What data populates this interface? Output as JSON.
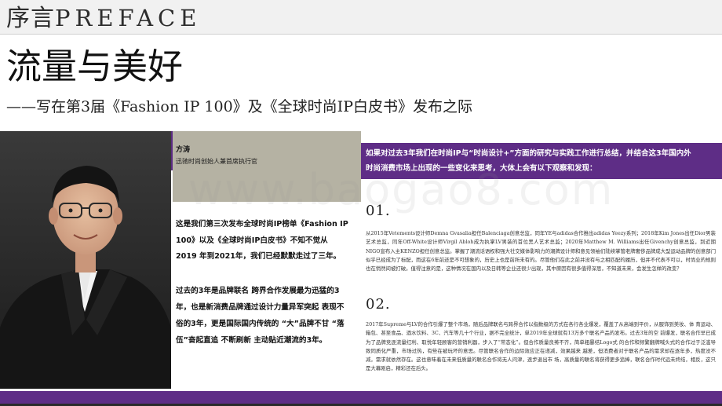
{
  "header": {
    "preface_cn": "序言",
    "preface_en": "PREFACE"
  },
  "title": "流量与美好",
  "subtitle": "——写在第3届《Fashion IP 100》及《全球时尚IP白皮书》发布之际",
  "author": {
    "name": "方涛",
    "role": "迅驰时尚创始人兼首席执行官"
  },
  "intro": {
    "p1_lines": [
      "这是我们第三次发布全球时尚IP榜单《Fashion IP",
      "100》以及《全球时尚IP白皮书》不知不觉从",
      "2019 年到2021年，我们已经默默走过了三年。"
    ],
    "p2_lines": [
      "过去的3年是品牌联名 跨界合作发展最为迅猛的3",
      "年，也是新消费品牌通过设计力量异军突起 表现不",
      "俗的3年，更是国际国内传统的 “大”品牌不甘 “落",
      "伍”奋起直追 不断刷新 主动贴近潮流的3年。"
    ]
  },
  "question": {
    "lines": [
      "如果对过去3年我们在时尚IP与“时尚设计+”方面的研究与实践工作进行总结，并结合这3年国内外",
      "时尚消费市场上出现的一些变化来思考，大体上会有以下观察和发现："
    ]
  },
  "sections": [
    {
      "number": "01.",
      "body": "从2015年Vetements设计师Demna Gvasalia担任Balenciaga创意总监，同年YE与adidas合作推出adidas Yeezy系列；2018年Kim Jones出任Dior男装艺术总监，同年Off-White设计师Virgil Abloh成为执掌LV男装的首位黑人艺术总监；2020年Matthew M. Williams出任Givenchy创意总监，到近期NIGO宣布入主KENZO担任创意总监。掌握了潮流话语权和强大社交媒体影响力的潮牌设计师和意见领袖们陆续掌管老牌奢侈品牌成大型运动品牌的创意部门似乎已经成为了标配，而这在6年前还是不可想象的，历史上也是前所未有的。尽管他们在此之前并没有与之相匹配的履历，但并不代表不可以，时尚业的规则也在悄然间被打破。值得注意的是，这种情况在国内以及日韩等企业还很少出现，其中原因有很多值得深思，不知道未来，会发生怎样的改变？"
    },
    {
      "number": "02.",
      "body": "2017年Supreme与LV的合作引爆了整个市场，随后品牌联名与跨界合作以指数级的方式在各行各业爆发，覆盖了从高端到平价，从服饰到美妆、体 育运动、箱包、甚至食品、酒水饮料、3C、汽车等几十个行业，据不完全统计，单2019年全球就有13万多个联名产品的发布。过去3年的空 前爆发，联名合作早已成为了品牌竞逐流量红利、取悦年轻顾客的营销利器，步入了“常态化”。但合作质量良莠不齐，简单粗暴结Logo式 的合作和频繁翻牌喊头式的合作过于泛滥导致同质化严重，市场过热，有些在被玩坏的意思。尽管联名合作的边际效应正在递减，效果越来 越差，但消费者对于联名产品的需求却在逐年多，热度没不减，需求就依然存在。这也意味着在未来低质量的联名合作将无人问津，逐步退出市 场，高质量的联名将获得更多追捧，联名合作时代远未终结，相反，这只是大幕刚启，精彩还在后头。"
    }
  ],
  "watermark": "www.baogao8.com",
  "colors": {
    "accent_purple": "#5e2d86",
    "name_box": "#b5b2a3"
  }
}
